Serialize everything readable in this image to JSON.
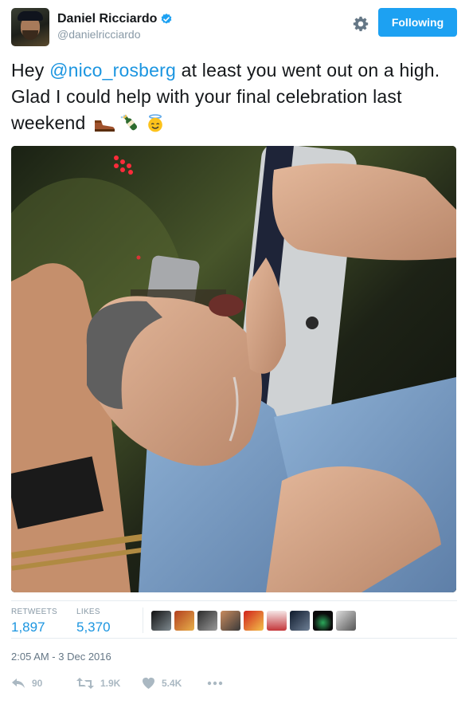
{
  "user": {
    "display_name": "Daniel Ricciardo",
    "handle": "@danielricciardo",
    "verified": true
  },
  "follow_button": {
    "label": "Following"
  },
  "tweet": {
    "text_before": "Hey ",
    "mention": "@nico_rosberg",
    "text_after": " at least you went out on a high. Glad I could help with your final celebration last weekend ",
    "emojis": [
      "shoe-emoji",
      "champagne-emoji",
      "angel-emoji"
    ]
  },
  "stats": {
    "retweets_label": "RETWEETS",
    "retweets_value": "1,897",
    "likes_label": "LIKES",
    "likes_value": "5,370",
    "liker_count": 9
  },
  "timestamp": "2:05 AM - 3 Dec 2016",
  "actions": {
    "reply_count": "90",
    "retweet_count": "1.9K",
    "like_count": "5.4K"
  },
  "colors": {
    "accent": "#1da1f2",
    "link": "#1b95e0",
    "muted": "#8899a6",
    "action_gray": "#aab8c2"
  }
}
